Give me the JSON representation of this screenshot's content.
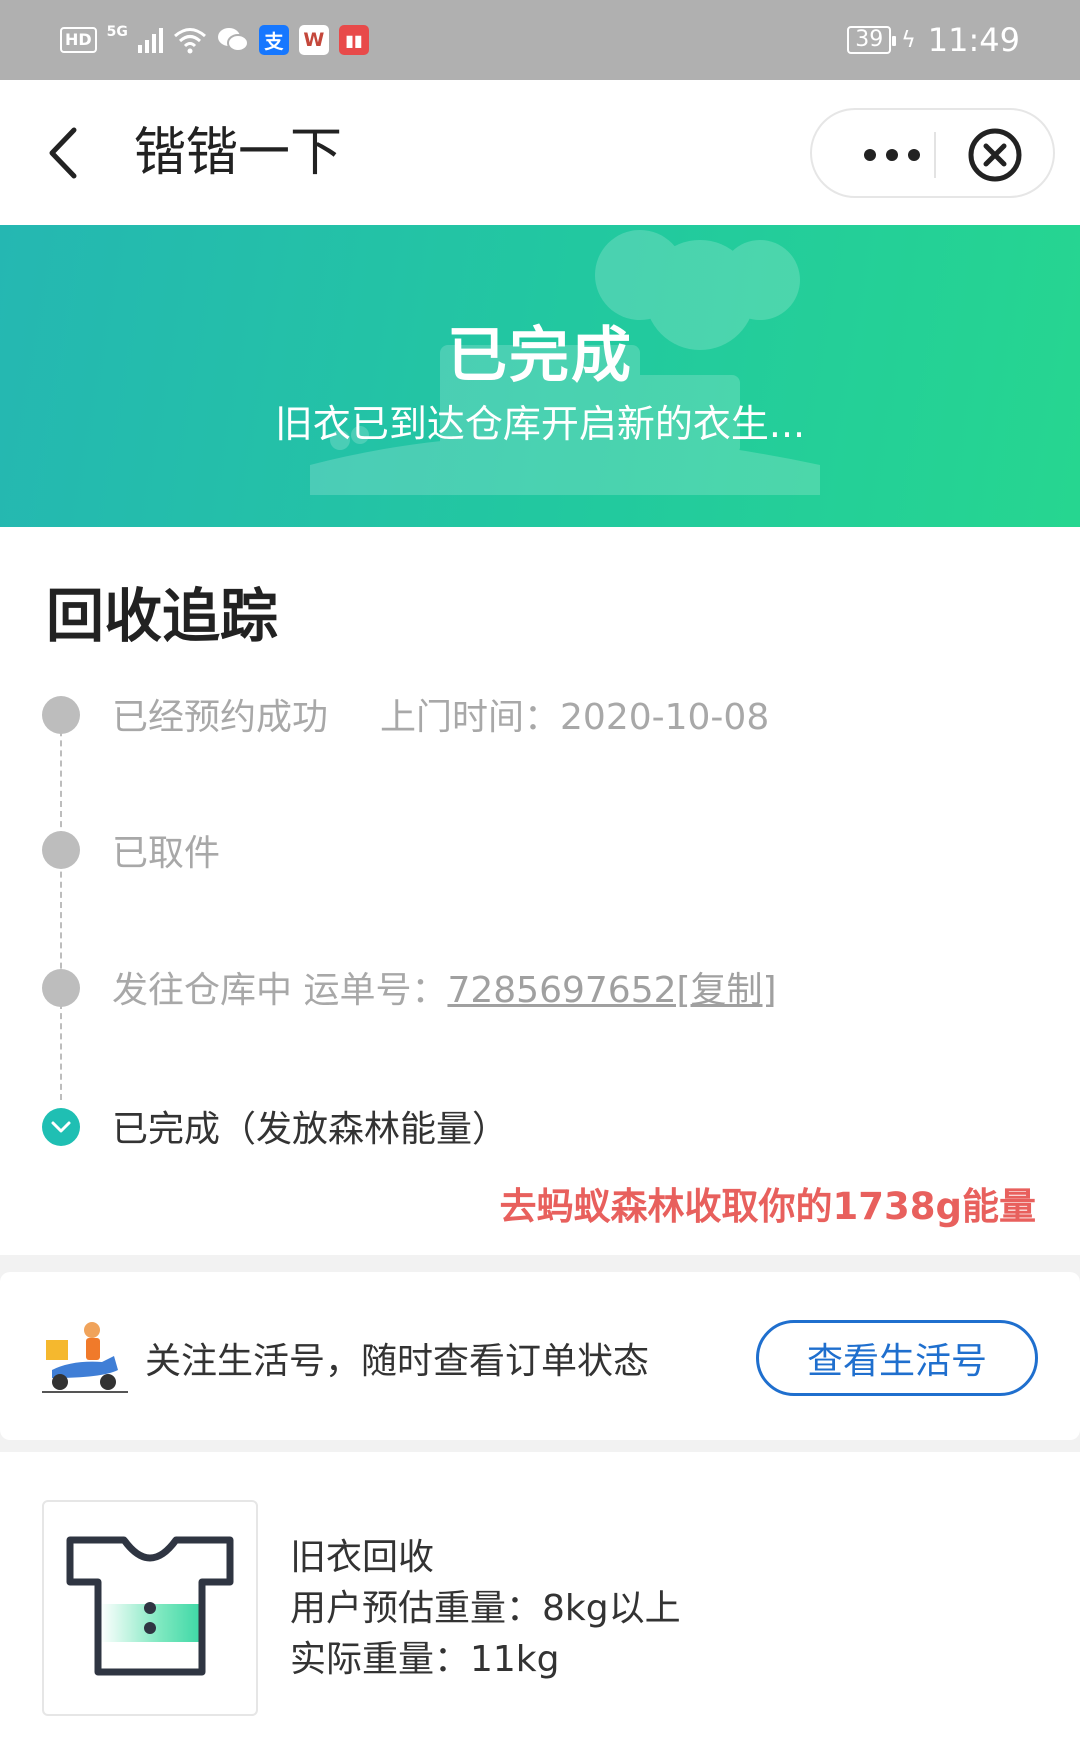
{
  "status_bar": {
    "hd": "HD",
    "network": "5G",
    "apps": [
      {
        "icon": "alipay-icon",
        "glyph": "支",
        "bg": "#1677ff",
        "fg": "#ffffff"
      },
      {
        "icon": "wps-icon",
        "glyph": "W",
        "bg": "#ffffff",
        "fg": "#c4473b"
      },
      {
        "icon": "book-icon",
        "glyph": "❚",
        "bg": "#e84a4a",
        "fg": "#ffffff"
      }
    ],
    "battery": "39",
    "time": "11:49"
  },
  "nav": {
    "title": "锴锴一下"
  },
  "banner": {
    "title": "已完成",
    "subtitle": "旧衣已到达仓库开启新的衣生..."
  },
  "tracking": {
    "title": "回收追踪",
    "steps": [
      {
        "label": "已经预约成功",
        "extra": "上门时间：2020-10-08"
      },
      {
        "label": "已取件"
      },
      {
        "label": "发往仓库中 运单号：",
        "waybill": "7285697652[复制]"
      },
      {
        "label": "已完成（发放森林能量）"
      }
    ],
    "energy_link": "去蚂蚁森林收取你的1738g能量"
  },
  "follow": {
    "text": "关注生活号，随时查看订单状态",
    "button": "查看生活号"
  },
  "item": {
    "name": "旧衣回收",
    "estimated": "用户预估重量：8kg以上",
    "actual": "实际重量：11kg"
  },
  "colors": {
    "banner_start": "#25b7b2",
    "banner_end": "#26d690",
    "done": "#1fbfb3",
    "energy": "#e8605d",
    "button": "#1f6fce"
  }
}
